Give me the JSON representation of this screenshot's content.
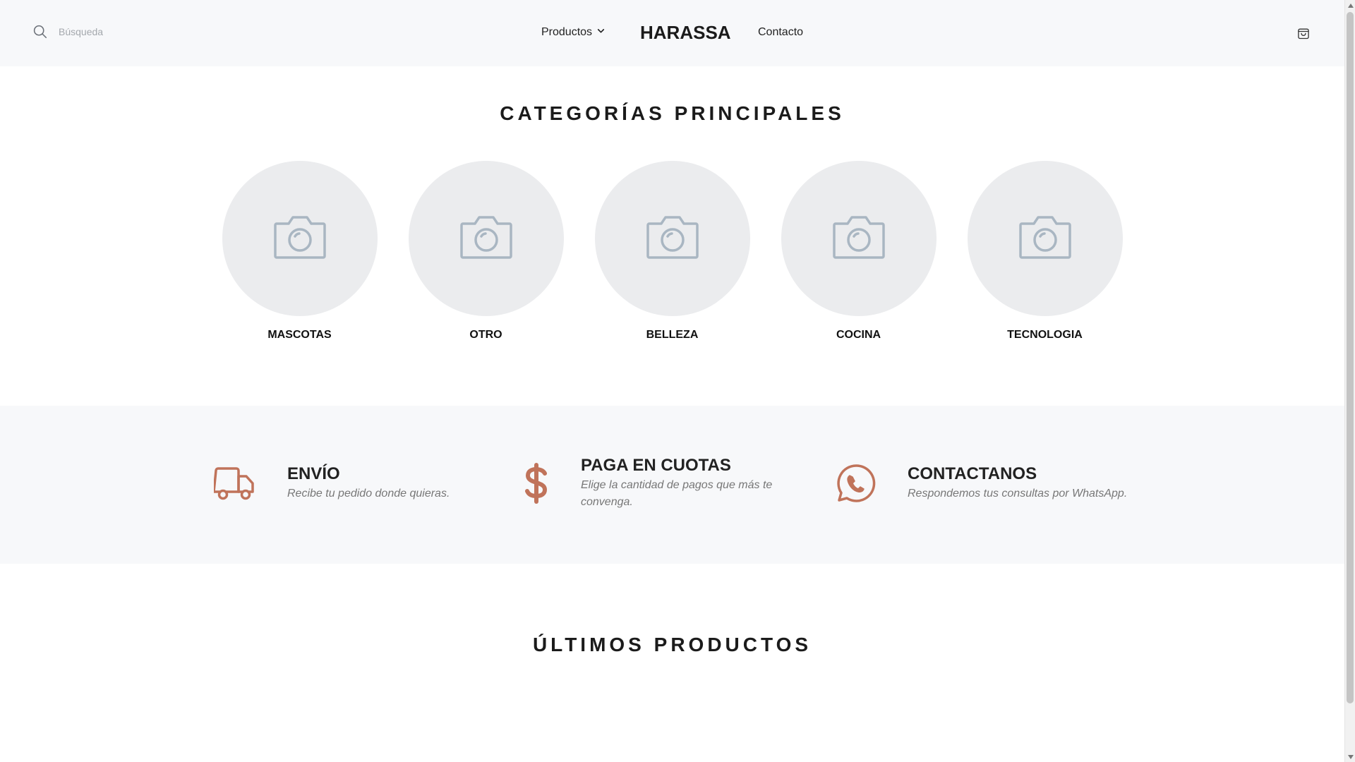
{
  "header": {
    "search": {
      "placeholder": "Búsqueda",
      "icon": "search-icon"
    },
    "nav": {
      "products_label": "Productos",
      "brand": "HARASSA",
      "contact_label": "Contacto"
    },
    "cart_icon": "shopping-bag-icon"
  },
  "categories": {
    "title": "CATEGORÍAS PRINCIPALES",
    "items": [
      {
        "label": "MASCOTAS",
        "icon": "camera-placeholder-icon"
      },
      {
        "label": "OTRO",
        "icon": "camera-placeholder-icon"
      },
      {
        "label": "BELLEZA",
        "icon": "camera-placeholder-icon"
      },
      {
        "label": "COCINA",
        "icon": "camera-placeholder-icon"
      },
      {
        "label": "TECNOLOGIA",
        "icon": "camera-placeholder-icon"
      }
    ]
  },
  "benefits": [
    {
      "title": "ENVÍO",
      "description": "Recibe tu pedido donde quieras.",
      "icon": "truck-icon"
    },
    {
      "title": "PAGA EN CUOTAS",
      "description": "Elige la cantidad de pagos que más te convenga.",
      "icon": "dollar-icon"
    },
    {
      "title": "CONTACTANOS",
      "description": "Respondemos tus consultas por WhatsApp.",
      "icon": "whatsapp-icon"
    }
  ],
  "latest": {
    "title": "ÚLTIMOS PRODUCTOS"
  },
  "colors": {
    "accent": "#c0735a",
    "placeholder_circle": "#ebecee",
    "placeholder_icon": "#a9b6c2",
    "band_background": "#f7f8fa"
  }
}
